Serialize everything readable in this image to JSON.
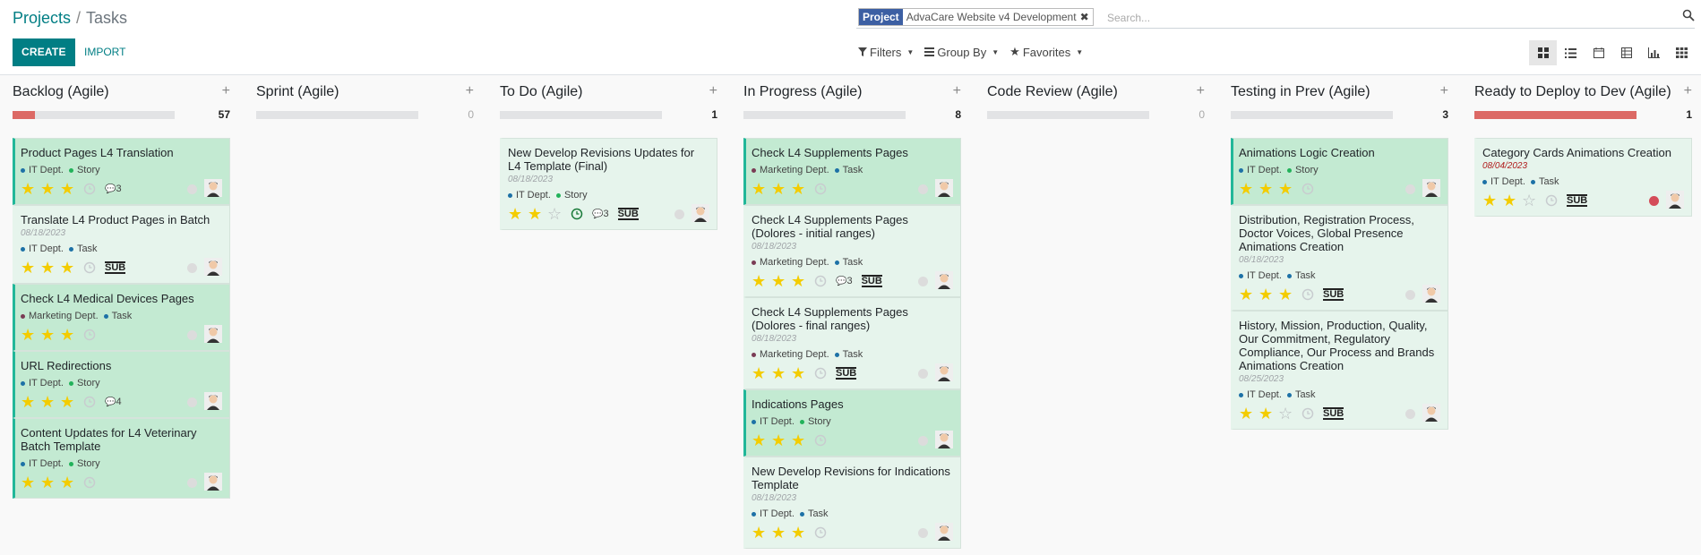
{
  "breadcrumb": {
    "parent": "Projects",
    "sep": "/",
    "current": "Tasks"
  },
  "buttons": {
    "create": "CREATE",
    "import": "IMPORT"
  },
  "search": {
    "facet_label": "Project",
    "facet_value": "AdvaCare Website v4 Development",
    "placeholder": "Search..."
  },
  "filters": {
    "filters": "Filters",
    "group_by": "Group By",
    "favorites": "Favorites"
  },
  "views": [
    "kanban-icon",
    "list-icon",
    "calendar-icon",
    "table-icon",
    "graph-icon",
    "grid-icon"
  ],
  "colors": {
    "accent": "#017e84",
    "highlight": "#c3ead2",
    "card": "#e6f4ec",
    "progress_red": "#dc6965",
    "star": "#f3cc00"
  },
  "columns": [
    {
      "title": "Backlog (Agile)",
      "count": "57",
      "progress": 0.14,
      "cards": [
        {
          "title": "Product Pages L4 Translation",
          "date": "",
          "tags": [
            [
              "IT Dept.",
              "#1d71a6"
            ],
            [
              "Story",
              "#22b25a"
            ]
          ],
          "stars": 3,
          "comments": "3",
          "sub": false,
          "hl": true,
          "state": "grey"
        },
        {
          "title": "Translate L4 Product Pages in Batch",
          "date": "08/18/2023",
          "tags": [
            [
              "IT Dept.",
              "#1d71a6"
            ],
            [
              "Task",
              "#1d71a6"
            ]
          ],
          "stars": 3,
          "comments": "",
          "sub": true,
          "hl": false,
          "state": "grey"
        },
        {
          "title": "Check L4 Medical Devices Pages",
          "date": "",
          "tags": [
            [
              "Marketing Dept.",
              "#7a3c55"
            ],
            [
              "Task",
              "#1d71a6"
            ]
          ],
          "stars": 3,
          "comments": "",
          "sub": false,
          "hl": true,
          "state": "grey"
        },
        {
          "title": "URL Redirections",
          "date": "",
          "tags": [
            [
              "IT Dept.",
              "#1d71a6"
            ],
            [
              "Story",
              "#22b25a"
            ]
          ],
          "stars": 3,
          "comments": "4",
          "sub": false,
          "hl": true,
          "state": "grey"
        },
        {
          "title": "Content Updates for L4 Veterinary Batch Template",
          "date": "",
          "tags": [
            [
              "IT Dept.",
              "#1d71a6"
            ],
            [
              "Story",
              "#22b25a"
            ]
          ],
          "stars": 3,
          "comments": "",
          "sub": false,
          "hl": true,
          "state": "grey"
        }
      ]
    },
    {
      "title": "Sprint (Agile)",
      "count": "0",
      "progress": 0,
      "cards": []
    },
    {
      "title": "To Do (Agile)",
      "count": "1",
      "progress": 0,
      "cards": [
        {
          "title": "New Develop Revisions Updates for L4 Template (Final)",
          "date": "08/18/2023",
          "tags": [
            [
              "IT Dept.",
              "#1d71a6"
            ],
            [
              "Story",
              "#22b25a"
            ]
          ],
          "stars": 2,
          "comments": "3",
          "sub": true,
          "hl": false,
          "state": "grey",
          "clock_green": true
        }
      ]
    },
    {
      "title": "In Progress (Agile)",
      "count": "8",
      "progress": 0,
      "cards": [
        {
          "title": "Check L4 Supplements Pages",
          "date": "",
          "tags": [
            [
              "Marketing Dept.",
              "#7a3c55"
            ],
            [
              "Task",
              "#1d71a6"
            ]
          ],
          "stars": 3,
          "comments": "",
          "sub": false,
          "hl": true,
          "state": "grey"
        },
        {
          "title": "Check L4 Supplements Pages (Dolores - initial ranges)",
          "date": "08/18/2023",
          "tags": [
            [
              "Marketing Dept.",
              "#7a3c55"
            ],
            [
              "Task",
              "#1d71a6"
            ]
          ],
          "stars": 3,
          "comments": "3",
          "sub": true,
          "hl": false,
          "state": "grey"
        },
        {
          "title": "Check L4 Supplements Pages (Dolores - final ranges)",
          "date": "08/18/2023",
          "tags": [
            [
              "Marketing Dept.",
              "#7a3c55"
            ],
            [
              "Task",
              "#1d71a6"
            ]
          ],
          "stars": 3,
          "comments": "",
          "sub": true,
          "hl": false,
          "state": "grey"
        },
        {
          "title": "Indications Pages",
          "date": "",
          "tags": [
            [
              "IT Dept.",
              "#1d71a6"
            ],
            [
              "Story",
              "#22b25a"
            ]
          ],
          "stars": 3,
          "comments": "",
          "sub": false,
          "hl": true,
          "state": "grey"
        },
        {
          "title": "New Develop Revisions for Indications Template",
          "date": "08/18/2023",
          "tags": [
            [
              "IT Dept.",
              "#1d71a6"
            ],
            [
              "Task",
              "#1d71a6"
            ]
          ],
          "stars": 3,
          "comments": "",
          "sub": false,
          "hl": false,
          "state": "grey"
        }
      ]
    },
    {
      "title": "Code Review (Agile)",
      "count": "0",
      "progress": 0,
      "cards": []
    },
    {
      "title": "Testing in Prev (Agile)",
      "count": "3",
      "progress": 0,
      "cards": [
        {
          "title": "Animations Logic Creation",
          "date": "",
          "tags": [
            [
              "IT Dept.",
              "#1d71a6"
            ],
            [
              "Story",
              "#22b25a"
            ]
          ],
          "stars": 3,
          "comments": "",
          "sub": false,
          "hl": true,
          "state": "grey"
        },
        {
          "title": "Distribution, Registration Process, Doctor Voices, Global Presence Animations Creation",
          "date": "08/18/2023",
          "tags": [
            [
              "IT Dept.",
              "#1d71a6"
            ],
            [
              "Task",
              "#1d71a6"
            ]
          ],
          "stars": 3,
          "comments": "",
          "sub": true,
          "hl": false,
          "state": "grey"
        },
        {
          "title": "History, Mission, Production, Quality, Our Commitment, Regulatory Compliance, Our Process and Brands Animations Creation",
          "date": "08/25/2023",
          "tags": [
            [
              "IT Dept.",
              "#1d71a6"
            ],
            [
              "Task",
              "#1d71a6"
            ]
          ],
          "stars": 2,
          "comments": "",
          "sub": true,
          "hl": false,
          "state": "grey"
        }
      ]
    },
    {
      "title": "Ready to Deploy to Dev (Agile)",
      "count": "1",
      "progress": 1,
      "cards": [
        {
          "title": "Category Cards Animations Creation",
          "date": "08/04/2023",
          "date_red": true,
          "tags": [
            [
              "IT Dept.",
              "#1d71a6"
            ],
            [
              "Task",
              "#1d71a6"
            ]
          ],
          "stars": 2,
          "comments": "",
          "sub": true,
          "hl": false,
          "state": "red"
        }
      ]
    }
  ]
}
